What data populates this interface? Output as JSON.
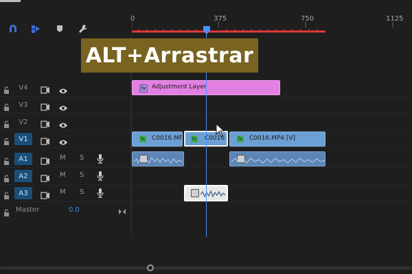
{
  "ruler": {
    "ticks": [
      "0",
      "375",
      "750",
      "1125"
    ]
  },
  "overlay": {
    "text": "ALT+Arrastrar",
    "bg_color": "#786320"
  },
  "toolbar": {
    "icons": [
      "magnet-snap-icon",
      "linked-selection-icon",
      "marker-icon",
      "wrench-icon"
    ],
    "accent_color": "#3a6fd8"
  },
  "tracks": [
    {
      "name": "V4",
      "type": "video",
      "active": false
    },
    {
      "name": "V3",
      "type": "video",
      "active": false
    },
    {
      "name": "V2",
      "type": "video",
      "active": false
    },
    {
      "name": "V1",
      "type": "video",
      "active": true
    },
    {
      "name": "A1",
      "type": "audio",
      "active": true,
      "mute": "M",
      "solo": "S"
    },
    {
      "name": "A2",
      "type": "audio",
      "active": true,
      "mute": "M",
      "solo": "S"
    },
    {
      "name": "A3",
      "type": "audio",
      "active": true,
      "mute": "M",
      "solo": "S"
    }
  ],
  "master": {
    "label": "Master",
    "value": "0.0"
  },
  "clips": {
    "adjustment": {
      "label": "Adjustment Layer",
      "color": "#e380e3"
    },
    "v1_left": {
      "label": "C0016.MP"
    },
    "v1_mid": {
      "label": "C0016"
    },
    "v1_right": {
      "label": "C0016.MP4 [V]"
    }
  },
  "colors": {
    "video_clip": "#6c9fd4",
    "audio_clip": "#5e86b5",
    "playhead": "#4a90ff",
    "work_area": "#e23a3a"
  }
}
